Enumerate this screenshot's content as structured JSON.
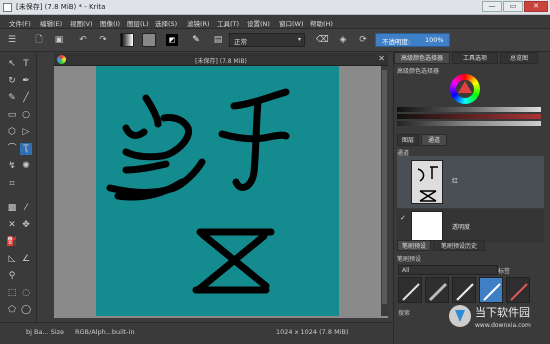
{
  "window": {
    "title": "[未保存]  (7.8 MiB) * - Krita",
    "controls": {
      "minimize": "—",
      "maximize": "▭",
      "close": "✕"
    }
  },
  "menu": [
    "文件(F)",
    "编辑(E)",
    "视图(V)",
    "图像(I)",
    "图层(L)",
    "选择(S)",
    "滤镜(R)",
    "工具(T)",
    "设置(N)",
    "窗口(W)",
    "帮助(H)"
  ],
  "toolbar": {
    "blend_mode": "正常",
    "opacity_label": "不透明度:",
    "opacity_value": "100%"
  },
  "document": {
    "tab_name": "[未保存]  (7.8 MiB)",
    "canvas_color": "#138b8f"
  },
  "status": {
    "brush": "bj Ba... Size",
    "colorspace": "RGB/Alph...built-in",
    "size": "1024 x 1024 (7.8 MiB)"
  },
  "dock": {
    "tabs_top": [
      "高级颜色选择器",
      "工具选项",
      "总览图"
    ],
    "color_selector_title": "高级颜色选择器",
    "layer_tabs": [
      "图层",
      "通道"
    ],
    "channels_title": "通道",
    "layers": [
      {
        "name": "红",
        "visible": false
      },
      {
        "name": "透明度",
        "visible": true
      }
    ],
    "brush_tabs": [
      "笔刷预设",
      "笔刷预设历史"
    ],
    "brush_presets_title": "笔刷预设",
    "brush_filter": "All",
    "tag_label": "标签",
    "search_label": "搜索"
  },
  "watermark": {
    "text": "当下软件园",
    "url": "www.downxia.com"
  },
  "colors": {
    "accent": "#3e7fc6",
    "canvas_teal": "#138b8f",
    "brush_stroke": "#000000"
  }
}
